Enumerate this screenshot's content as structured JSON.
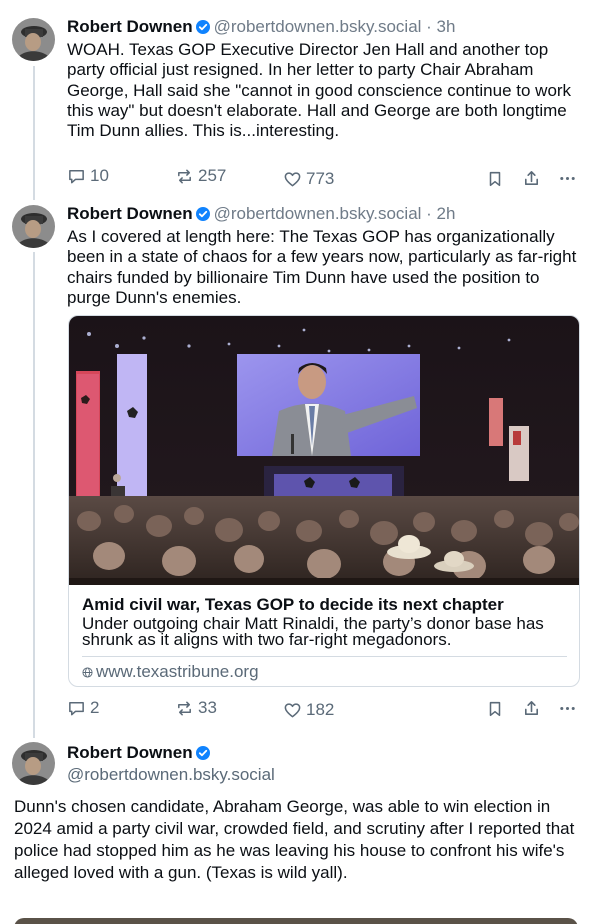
{
  "posts": [
    {
      "author": "Robert Downen",
      "handle": "@robertdownen.bsky.social",
      "time": "· 3h",
      "text": "WOAH. Texas GOP Executive Director Jen Hall and another top party official just resigned. In her letter to party Chair Abraham George, Hall said she \"cannot in good conscience continue to work this way\" but doesn't elaborate. Hall and George are both longtime Tim Dunn allies. This is...interesting.",
      "replies": "10",
      "reposts": "257",
      "likes": "773"
    },
    {
      "author": "Robert Downen",
      "handle": "@robertdownen.bsky.social",
      "time": "· 2h",
      "text": "As I covered at length here: The Texas GOP has organizationally been in a state of chaos for a few years now, particularly as far-right chairs funded by billionaire Tim Dunn have used the position to purge Dunn's enemies.",
      "card": {
        "title": "Amid civil war, Texas GOP to decide its next chapter",
        "description": "Under outgoing chair Matt Rinaldi, the party’s donor base has shrunk as it aligns with two far-right megadonors.",
        "domain": "www.texastribune.org"
      },
      "replies": "2",
      "reposts": "33",
      "likes": "182"
    },
    {
      "author": "Robert Downen",
      "handle": "@robertdownen.bsky.social",
      "text": "Dunn's chosen candidate, Abraham George, was able to win election in 2024 amid a party civil war, crowded field, and scrutiny after I reported that police had stopped him as he was leaving his house to confront his wife's alleged loved with a gun. (Texas is wild yall)."
    }
  ],
  "icons": {
    "reply": "reply-bubble-icon",
    "repost": "repost-arrows-icon",
    "like": "heart-icon",
    "bookmark": "bookmark-icon",
    "share": "share-icon",
    "more": "more-dots-icon",
    "verified": "verified-badge-icon",
    "globe": "globe-icon"
  },
  "colors": {
    "verified": "#1083fe",
    "muted": "#5b6a78",
    "border": "#d4dbe2"
  }
}
